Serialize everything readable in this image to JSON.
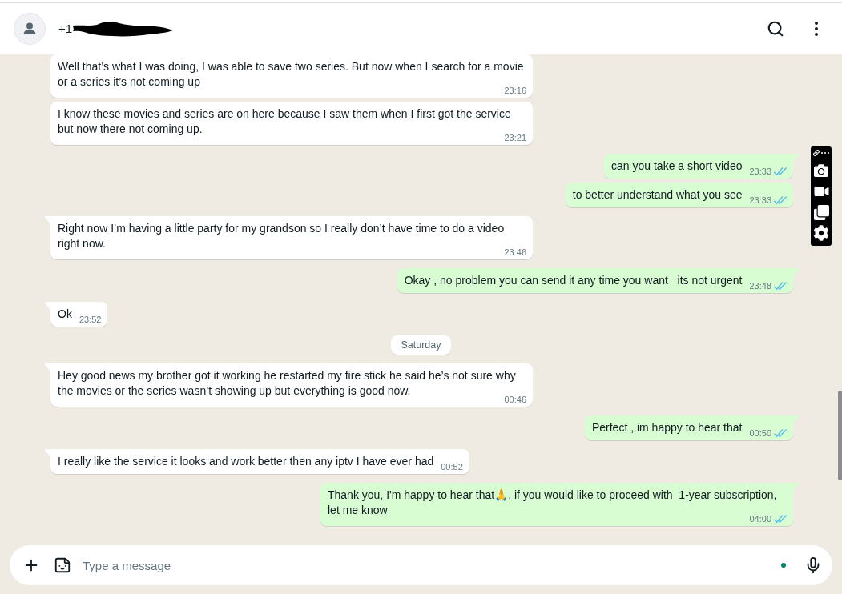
{
  "header": {
    "contact_name": "+1"
  },
  "messages": [
    {
      "kind": "message",
      "outgoing": false,
      "text": "Well that’s what I was doing, I was able to save two series. But now when I search for a movie or a series it’s not coming up",
      "time": "23:16"
    },
    {
      "kind": "message",
      "outgoing": false,
      "text": "I know these movies and series are on here because I saw them when I first got the service but now there not coming up.",
      "time": "23:21"
    },
    {
      "kind": "message",
      "outgoing": true,
      "text": "can you take a short video",
      "time": "23:33",
      "read": true
    },
    {
      "kind": "message",
      "outgoing": true,
      "text": "to better understand what you see",
      "time": "23:33",
      "read": true
    },
    {
      "kind": "message",
      "outgoing": false,
      "text": "Right now I’m having a little party for my grandson so I really don’t have time to do a video right now.",
      "time": "23:46"
    },
    {
      "kind": "message",
      "outgoing": true,
      "text": "Okay , no problem you can send it any time you want   its not urgent",
      "time": "23:48",
      "read": true
    },
    {
      "kind": "message",
      "outgoing": false,
      "text": "Ok",
      "time": "23:52"
    },
    {
      "kind": "date",
      "label": "Saturday"
    },
    {
      "kind": "message",
      "outgoing": false,
      "text": "Hey good news my brother got it working he restarted my fire stick he said he’s not sure why the movies or the series wasn’t showing up but everything is good now.",
      "time": "00:46"
    },
    {
      "kind": "message",
      "outgoing": true,
      "text": "Perfect , im happy to hear that",
      "time": "00:50",
      "read": true
    },
    {
      "kind": "message",
      "outgoing": false,
      "text": "I really like the service it looks and work better then any iptv I have ever had",
      "time": "00:52"
    },
    {
      "kind": "message",
      "outgoing": true,
      "text": "Thank you, I'm happy to hear that🙏, if you would like to proceed with  1-year subscription, let me know",
      "time": "04:00",
      "read": true
    }
  ],
  "composer": {
    "placeholder": "Type a message"
  }
}
